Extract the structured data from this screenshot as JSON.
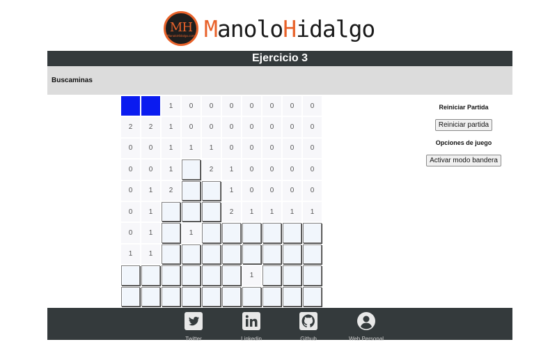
{
  "logo": {
    "badge_text": "MH",
    "badge_subtext": "ManoloHidalgo.com",
    "brand_first_initial": "M",
    "brand_first_rest": "anolo",
    "brand_last_initial": "H",
    "brand_last_rest": "idalgo"
  },
  "header": {
    "title": "Ejercicio 3"
  },
  "subheader": {
    "label": "Buscaminas"
  },
  "board": {
    "cells": [
      [
        "F",
        "F",
        "1",
        "0",
        "0",
        "0",
        "0",
        "0",
        "0",
        "0"
      ],
      [
        "2",
        "2",
        "1",
        "0",
        "0",
        "0",
        "0",
        "0",
        "0",
        "0"
      ],
      [
        "0",
        "0",
        "1",
        "1",
        "1",
        "0",
        "0",
        "0",
        "0",
        "0"
      ],
      [
        "0",
        "0",
        "1",
        "H",
        "2",
        "1",
        "0",
        "0",
        "0",
        "0"
      ],
      [
        "0",
        "1",
        "2",
        "H",
        "H",
        "1",
        "0",
        "0",
        "0",
        "0"
      ],
      [
        "0",
        "1",
        "H",
        "H",
        "H",
        "2",
        "1",
        "1",
        "1",
        "1"
      ],
      [
        "0",
        "1",
        "H",
        "1",
        "H",
        "H",
        "H",
        "H",
        "H",
        "H"
      ],
      [
        "1",
        "1",
        "H",
        "H",
        "H",
        "H",
        "H",
        "H",
        "H",
        "H"
      ],
      [
        "H",
        "H",
        "H",
        "H",
        "H",
        "H",
        "1",
        "H",
        "H",
        "H"
      ],
      [
        "H",
        "H",
        "H",
        "H",
        "H",
        "H",
        "H",
        "H",
        "H",
        "H"
      ]
    ]
  },
  "panel": {
    "restart_heading": "Reiniciar Partida",
    "restart_button": "Reiniciar partida",
    "options_heading": "Opciones de juego",
    "flag_button": "Activar modo bandera"
  },
  "footer": {
    "links": [
      {
        "label": "Twitter",
        "icon": "twitter-icon"
      },
      {
        "label": "Linkedin",
        "icon": "linkedin-icon"
      },
      {
        "label": "Github",
        "icon": "github-icon"
      },
      {
        "label": "Web Personal",
        "icon": "user-icon"
      }
    ]
  },
  "colors": {
    "accent": "#e8622a",
    "bar": "#343a3c",
    "flag": "#0a1bf0",
    "subbar": "#dcdcdc"
  }
}
